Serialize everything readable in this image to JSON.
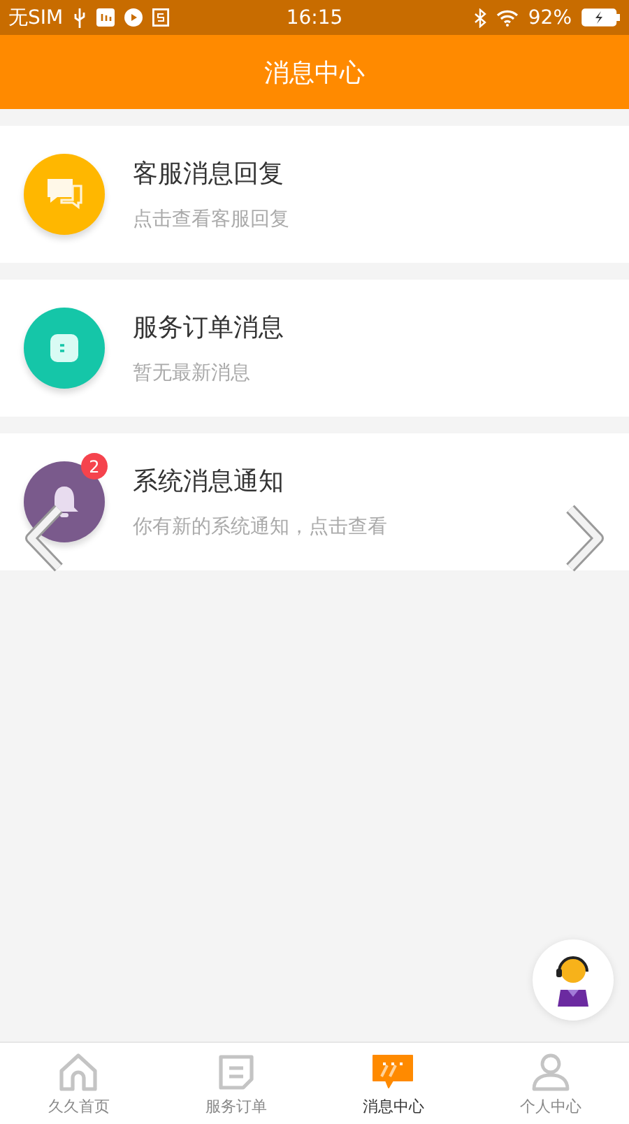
{
  "status_bar": {
    "carrier": "无SIM",
    "time": "16:15",
    "battery": "92%"
  },
  "header": {
    "title": "消息中心"
  },
  "messages": [
    {
      "kind": "chat",
      "title": "客服消息回复",
      "subtitle": "点击查看客服回复",
      "color": "#ffb700"
    },
    {
      "kind": "order",
      "title": "服务订单消息",
      "subtitle": "暂无最新消息",
      "color": "#15c6a8"
    },
    {
      "kind": "bell",
      "title": "系统消息通知",
      "subtitle": "你有新的系统通知，点击查看",
      "color": "#7a5a8c",
      "badge": "2"
    }
  ],
  "tab_bar": [
    {
      "kind": "home",
      "label": "久久首页",
      "selected": false
    },
    {
      "kind": "order",
      "label": "服务订单",
      "selected": false
    },
    {
      "kind": "message",
      "label": "消息中心",
      "selected": true
    },
    {
      "kind": "person",
      "label": "个人中心",
      "selected": false
    }
  ]
}
